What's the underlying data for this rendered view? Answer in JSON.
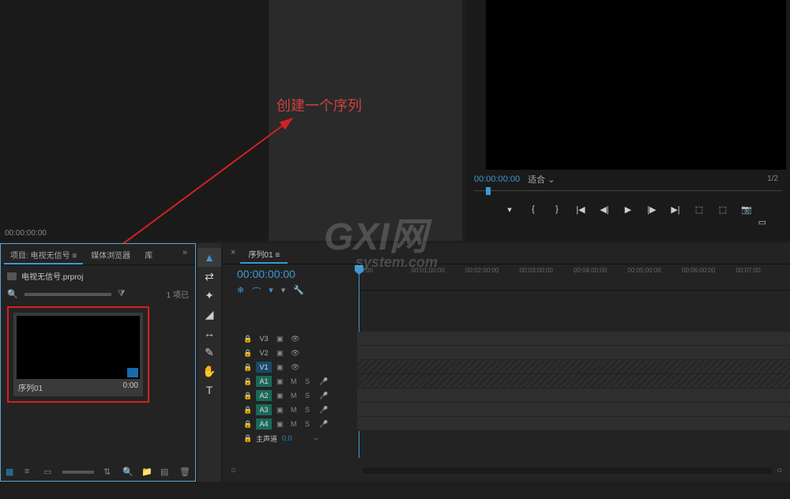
{
  "annotation": {
    "text": "创建一个序列"
  },
  "source": {
    "timecode": "00:00:00:00"
  },
  "program": {
    "timecode": "00:00:00:00",
    "zoom": "适合",
    "counter": "1/2"
  },
  "project": {
    "tabs": [
      "项目: 电视无信号",
      "媒体浏览器",
      "库"
    ],
    "name": "电视无信号.prproj",
    "item_count": "1 项已",
    "sequence": {
      "name": "序列01",
      "duration": "0:00"
    }
  },
  "timeline": {
    "tab": "序列01",
    "timecode": "00:00:00:00",
    "ruler": [
      "00:00",
      "00:01:00:00",
      "00:02:00:00",
      "00:03:00:00",
      "00:04:00:00",
      "00:05:00:00",
      "00:06:00:00",
      "00:07:00"
    ],
    "video_tracks": [
      "V3",
      "V2",
      "V1"
    ],
    "audio_tracks": [
      "A1",
      "A2",
      "A3",
      "A4"
    ],
    "track_controls": {
      "mute": "M",
      "solo": "S"
    },
    "master": {
      "label": "主声道",
      "value": "0.0"
    }
  },
  "watermark": {
    "line1": "GXI网",
    "line2": "system.com"
  }
}
